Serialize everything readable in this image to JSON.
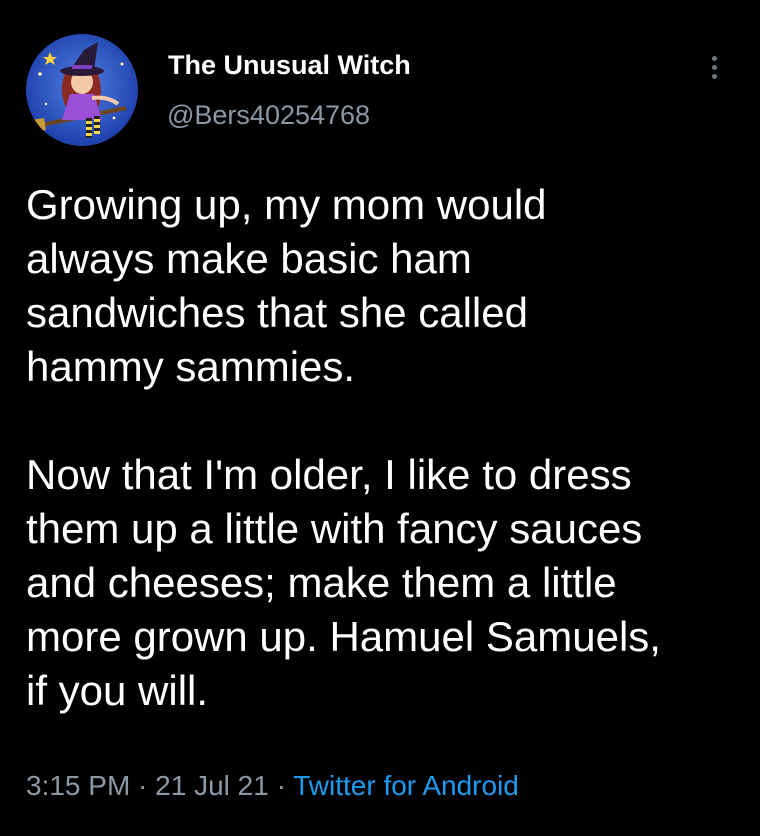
{
  "author": {
    "display_name": "The Unusual Witch",
    "handle": "@Bers40254768"
  },
  "tweet": {
    "paragraphs": [
      {
        "lines": [
          "Growing up, my mom would",
          "always make basic ham",
          "sandwiches that she called",
          "hammy sammies."
        ]
      },
      {
        "lines": [
          "Now that I'm older, I like to dress",
          "them up a little with fancy sauces",
          "and cheeses; make them a little",
          "more grown up. Hamuel Samuels,",
          "if you will."
        ]
      }
    ]
  },
  "meta": {
    "time": "3:15 PM",
    "sep1": " · ",
    "date": "21 Jul 21",
    "sep2": " · ",
    "source": "Twitter for Android"
  },
  "icons": {
    "menu": "more-vertical-icon"
  },
  "colors": {
    "background": "#000000",
    "text": "#ffffff",
    "secondary": "#8b98a5",
    "link": "#1d9bf0"
  }
}
